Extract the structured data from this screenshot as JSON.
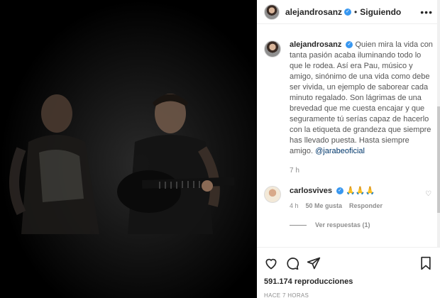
{
  "header": {
    "username": "alejandrosanz",
    "separator": "•",
    "following_label": "Siguiendo",
    "more_icon": "more-options-icon"
  },
  "caption": {
    "username": "alejandrosanz",
    "text": "Quien mira la vida con tanta pasión acaba iluminando todo lo que le rodea. Así era Pau, músico y amigo, sinónimo de una vida como debe ser vivida, un ejemplo de saborear cada minuto regalado. Son lágrimas de una brevedad que me cuesta encajar y que seguramente tú serías capaz de hacerlo con la etiqueta de grandeza que siempre has llevado puesta. Hasta siempre amigo.",
    "mention": "@jarabeoficial",
    "time": "7 h"
  },
  "comment": {
    "username": "carlosvives",
    "text": "🙏🙏🙏",
    "time": "4 h",
    "likes": "50 Me gusta",
    "reply_label": "Responder",
    "view_replies": "Ver respuestas (1)"
  },
  "actions": {
    "views": "591.174 reproducciones",
    "time_ago": "HACE 7 HORAS"
  },
  "colors": {
    "verified": "#3897f0",
    "mention": "#00376b",
    "muted": "#8e8e8e"
  }
}
